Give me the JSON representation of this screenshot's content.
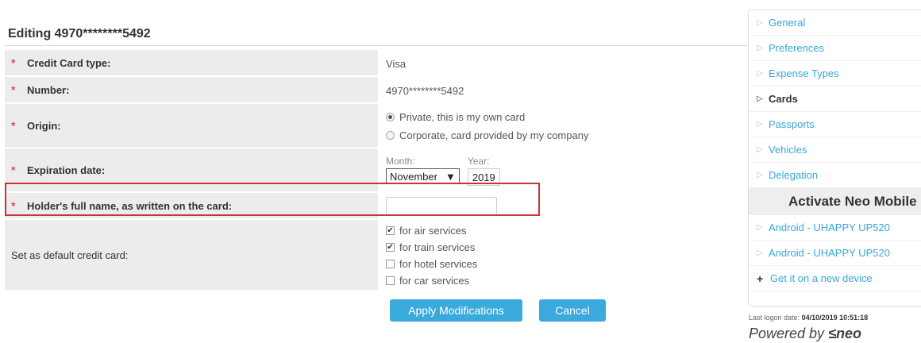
{
  "page": {
    "title": "Editing 4970********5492"
  },
  "form": {
    "card_type": {
      "label": "Credit Card type:",
      "value": "Visa"
    },
    "number": {
      "label": "Number:",
      "value": "4970********5492"
    },
    "origin": {
      "label": "Origin:",
      "options": [
        {
          "label": "Private, this is my own card",
          "selected": true
        },
        {
          "label": "Corporate, card provided by my company",
          "selected": false
        }
      ]
    },
    "expiration": {
      "label": "Expiration date:",
      "month_label": "Month:",
      "month_value": "November",
      "year_label": "Year:",
      "year_value": "2019"
    },
    "holder": {
      "label": "Holder's full name, as written on the card:",
      "value": ""
    },
    "default": {
      "label": "Set as default credit card:",
      "options": [
        {
          "label": "for air services",
          "checked": true
        },
        {
          "label": "for train services",
          "checked": true
        },
        {
          "label": "for hotel services",
          "checked": false
        },
        {
          "label": "for car services",
          "checked": false
        }
      ]
    },
    "required_mark": "*"
  },
  "buttons": {
    "apply": "Apply Modifications",
    "cancel": "Cancel"
  },
  "sidebar": {
    "items": [
      {
        "label": "General"
      },
      {
        "label": "Preferences"
      },
      {
        "label": "Expense Types"
      },
      {
        "label": "Cards"
      },
      {
        "label": "Passports"
      },
      {
        "label": "Vehicles"
      },
      {
        "label": "Delegation"
      }
    ],
    "mobile_header": "Activate Neo Mobile",
    "devices": [
      {
        "label": "Android - UHAPPY UP520"
      },
      {
        "label": "Android - UHAPPY UP520"
      }
    ],
    "new_device": "Get it on a new device"
  },
  "footer": {
    "logon_label": "Last logon date:",
    "logon_value": "04/10/2019 10:51:18",
    "powered_by": "Powered by",
    "brand": "neo"
  },
  "colors": {
    "accent": "#3aa9dc",
    "required": "#d9534f",
    "highlight": "#cc3333"
  }
}
